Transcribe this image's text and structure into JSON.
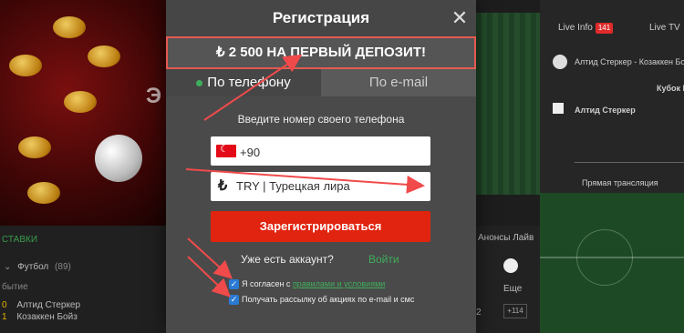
{
  "modal": {
    "title": "Регистрация",
    "close_glyph": "✕",
    "promo": "₺ 2 500 НА ПЕРВЫЙ ДЕПОЗИТ!",
    "tabs": [
      {
        "label": "По телефону",
        "active": true
      },
      {
        "label": "По e-mail",
        "active": false
      }
    ],
    "prompt": "Введите номер своего телефона",
    "phone": {
      "country": "Turkey",
      "flag_icon": "turkey-flag-icon",
      "value": "+90"
    },
    "currency": {
      "icon": "₺",
      "label": "TRY | Турецкая лира",
      "caret": "▼"
    },
    "register_label": "Зарегистрироваться",
    "has_account": "Уже есть аккаунт?",
    "login_label": "Войти",
    "consent_prefix": "Я согласен с ",
    "consent_link": "правилами и условиями",
    "newsletter": "Получать рассылку об акциях по e-mail и смс",
    "colors": {
      "accent_red": "#e1240f",
      "accent_green": "#3fae5b",
      "banner_border": "#e35a50",
      "checkbox_blue": "#2a7ad4"
    }
  },
  "background": {
    "promo_partial": "Э",
    "bets_header": "СТАВКИ",
    "sport": "Футбол",
    "sport_count": "(89)",
    "event_label": "бытие",
    "team1_index": "0",
    "team1": "Алтид Стеркер",
    "team2_index": "1",
    "team2": "Козаккен Бойз",
    "anons": "Анонсы Лайв",
    "odds_label": "Еще",
    "odds_value": "2",
    "more_count": "+114"
  },
  "right_panel": {
    "tab_live": "Live Info",
    "tab_live_count": "141",
    "tab_tv": "Live TV",
    "match": "Алтид Стеркер - Козаккен Бойз",
    "tournament": "Кубок Н",
    "team_home": "Алтид Стеркер",
    "stream_label": "Прямая трансляция"
  }
}
